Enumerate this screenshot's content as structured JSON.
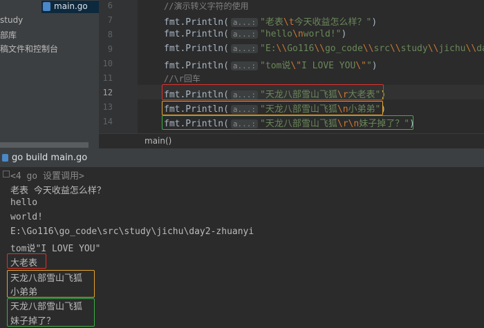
{
  "sidebar": {
    "file_name": "main.go",
    "items": [
      "study",
      "部库",
      "稿文件和控制台"
    ]
  },
  "editor": {
    "line_numbers": [
      "6",
      "7",
      "8",
      "9",
      "10",
      "11",
      "12",
      "13",
      "14"
    ],
    "param_hint": "a...:",
    "lines": [
      {
        "type": "comment",
        "text": "//演示转义字符的使用"
      },
      {
        "type": "call",
        "fn": "fmt.Println(",
        "parts": [
          {
            "s": "\"老表"
          },
          {
            "e": "\\t"
          },
          {
            "s": "今天收益怎么样？\""
          }
        ],
        "close": ")"
      },
      {
        "type": "call",
        "fn": "fmt.Println(",
        "parts": [
          {
            "s": "\"hello"
          },
          {
            "e": "\\n"
          },
          {
            "s": "world!\""
          }
        ],
        "close": ")"
      },
      {
        "type": "call",
        "fn": "fmt.Println(",
        "parts": [
          {
            "s": "\"E:"
          },
          {
            "e": "\\\\"
          },
          {
            "s": "Go116"
          },
          {
            "e": "\\\\"
          },
          {
            "s": "go_code"
          },
          {
            "e": "\\\\"
          },
          {
            "s": "src"
          },
          {
            "e": "\\\\"
          },
          {
            "s": "study"
          },
          {
            "e": "\\\\"
          },
          {
            "s": "jichu"
          },
          {
            "e": "\\\\"
          },
          {
            "s": "da"
          }
        ],
        "close": ""
      },
      {
        "type": "call",
        "fn": "fmt.Println(",
        "parts": [
          {
            "s": "\"tom说"
          },
          {
            "e": "\\\""
          },
          {
            "s": "I LOVE YOU"
          },
          {
            "e": "\\\""
          },
          {
            "s": "\""
          }
        ],
        "close": ")"
      },
      {
        "type": "comment",
        "text": "//\\r回车"
      },
      {
        "type": "call",
        "fn": "fmt.Println(",
        "parts": [
          {
            "s": "\"天龙八部雪山飞狐"
          },
          {
            "e": "\\r"
          },
          {
            "s": "大老表\""
          }
        ],
        "close": ")"
      },
      {
        "type": "call",
        "fn": "fmt.Println(",
        "parts": [
          {
            "s": "\"天龙八部雪山飞狐"
          },
          {
            "e": "\\n"
          },
          {
            "s": "小弟弟\""
          }
        ],
        "close": ")"
      },
      {
        "type": "call",
        "fn": "fmt.Println(",
        "parts": [
          {
            "s": "\"天龙八部雪山飞狐"
          },
          {
            "e": "\\r\\n"
          },
          {
            "s": "妹子掉了？\""
          }
        ],
        "close": ")"
      }
    ]
  },
  "breadcrumb": "main()",
  "run": {
    "tab_label": "go build main.go",
    "output": [
      "<4 go 设置调用>",
      "老表 今天收益怎么样？",
      "hello",
      "world!",
      "E:\\Go116\\go_code\\src\\study\\jichu\\day2-zhuanyi",
      "tom说\"I LOVE YOU\"",
      "大老表",
      "天龙八部雪山飞狐",
      "小弟弟",
      "天龙八部雪山飞狐",
      "妹子掉了？"
    ]
  },
  "colors": {
    "red_box": "#e0312e",
    "orange_box": "#e7a52b",
    "green_box": "#3bb143"
  }
}
